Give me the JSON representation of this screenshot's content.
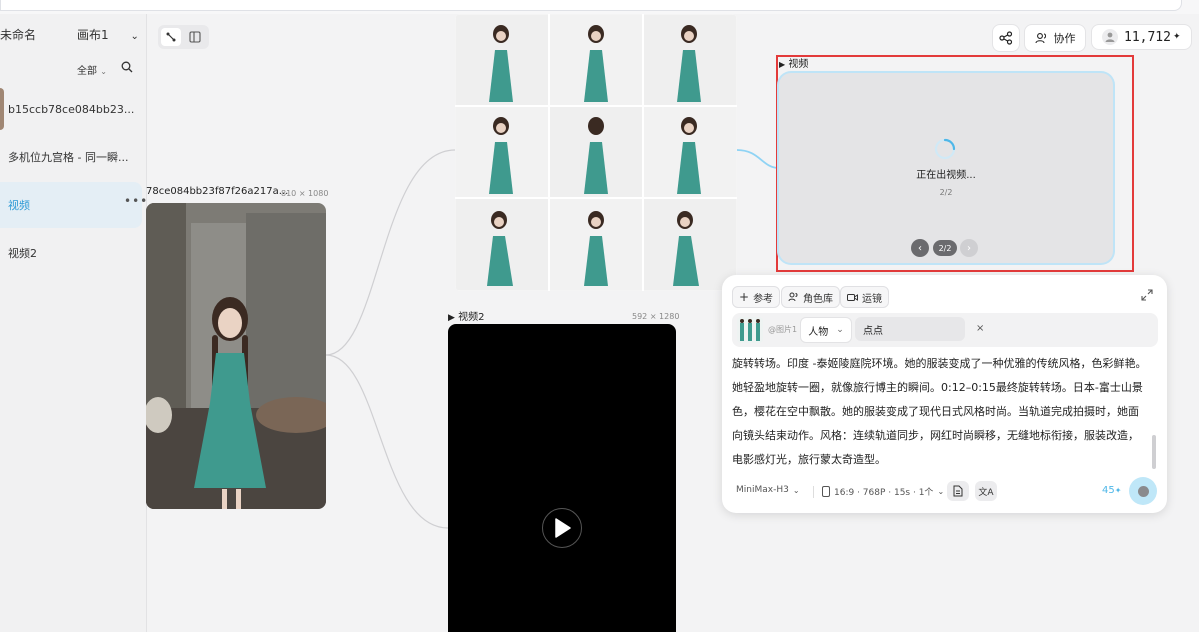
{
  "sidebar": {
    "project_name": "未命名",
    "canvas": "画布1",
    "filter": "全部",
    "items": [
      {
        "label": "b15ccb78ce084bb23..."
      },
      {
        "label": "多机位九宫格 - 同一瞬..."
      },
      {
        "label": "视频"
      },
      {
        "label": "视频2"
      }
    ]
  },
  "nodes": {
    "image": {
      "title": "78ce084bb23f87f26a217a...",
      "size": "810 × 1080"
    },
    "video2": {
      "title": "视频2",
      "size": "592 × 1280"
    },
    "video": {
      "title": "视频",
      "status": "正在出视频...",
      "count": "2/2",
      "page": "2/2"
    }
  },
  "topbar": {
    "collab": "协作",
    "credits": "11,712"
  },
  "panel": {
    "chips": {
      "ref": "参考",
      "roles": "角色库",
      "camera": "运镜"
    },
    "ref_image_label": "@图片1",
    "role_select": "人物",
    "role_name": "点点",
    "prompt": "旋转转场。印度 -泰姬陵庭院环境。她的服装变成了一种优雅的传统风格，色彩鲜艳。她轻盈地旋转一圈，就像旅行博主的瞬间。0:12–0:15最终旋转转场。日本-富士山景色，樱花在空中飘散。她的服装变成了现代日式风格时尚。当轨道完成拍摄时，她面向镜头结束动作。风格：连续轨道同步，网红时尚瞬移，无缝地标衔接，服装改造，电影感灯光，旅行蒙太奇造型。",
    "model": "MiniMax-H3",
    "settings": "16:9 · 768P · 15s · 1个",
    "cost": "45"
  },
  "colors": {
    "accent": "#2e9bd6",
    "highlight": "#e33a3a"
  }
}
